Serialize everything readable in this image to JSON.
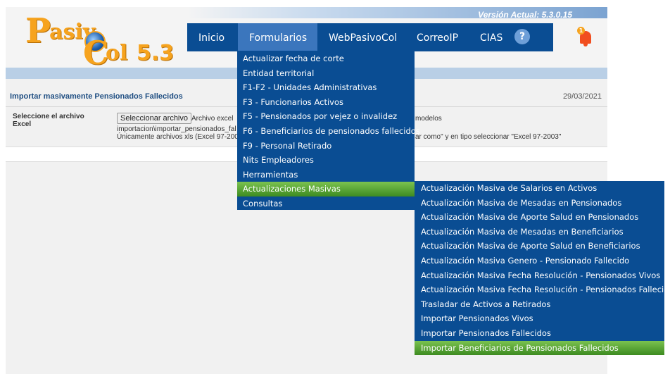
{
  "header": {
    "logo_text": "PasivoCol 5.3",
    "version": "Versión Actual: 5.3.0.15",
    "notification_count": "1",
    "help_label": "?"
  },
  "nav": {
    "items": [
      {
        "label": "Inicio"
      },
      {
        "label": "Formularios"
      },
      {
        "label": "WebPasivoCol"
      },
      {
        "label": "CorreoIP"
      },
      {
        "label": "CIAS"
      }
    ]
  },
  "content": {
    "title": "Importar masivamente Pensionados Fallecidos",
    "date": "29/03/2021",
    "field_label": "Seleccione el archivo Excel",
    "file_button": "Seleccionar archivo",
    "line1": "Archivo excel",
    "line1_tail": "modelos",
    "line2": "importacion\\importar_pensionados_fal",
    "line3": "Únicamente archivos xls (Excel 97-200",
    "line3_tail": "ar como\" y en tipo seleccionar \"Excel 97-2003\""
  },
  "dropdown": {
    "items": [
      {
        "label": "Actualizar fecha de corte"
      },
      {
        "label": "Entidad territorial"
      },
      {
        "label": "F1-F2 - Unidades Administrativas"
      },
      {
        "label": "F3 - Funcionarios Activos"
      },
      {
        "label": "F5 - Pensionados por vejez o invalidez"
      },
      {
        "label": "F6 - Beneficiarios de pensionados fallecidos"
      },
      {
        "label": "F9 - Personal Retirado"
      },
      {
        "label": "Nits Empleadores"
      },
      {
        "label": "Herramientas"
      },
      {
        "label": "Actualizaciones Masivas"
      },
      {
        "label": "Consultas"
      }
    ]
  },
  "submenu": {
    "items": [
      {
        "label": "Actualización Masiva de Salarios en Activos"
      },
      {
        "label": "Actualización Masiva de Mesadas en Pensionados"
      },
      {
        "label": "Actualización Masiva de Aporte Salud en Pensionados"
      },
      {
        "label": "Actualización Masiva de Mesadas en Beneficiarios"
      },
      {
        "label": "Actualización Masiva de Aporte Salud en Beneficiarios"
      },
      {
        "label": "Actualización Masiva Genero - Pensionado Fallecido"
      },
      {
        "label": "Actualización Masiva Fecha Resolución - Pensionados Vivos"
      },
      {
        "label": "Actualización Masiva Fecha Resolución - Pensionados Fallecidos"
      },
      {
        "label": "Trasladar de Activos a Retirados"
      },
      {
        "label": "Importar Pensionados Vivos"
      },
      {
        "label": "Importar Pensionados Fallecidos"
      },
      {
        "label": "Importar Beneficiarios de Pensionados Fallecidos"
      }
    ]
  },
  "colors": {
    "nav_bg": "#0a4d93",
    "nav_active": "#3b76bd",
    "highlight": "#5aa838",
    "logo_orange": "#f6a31e"
  }
}
